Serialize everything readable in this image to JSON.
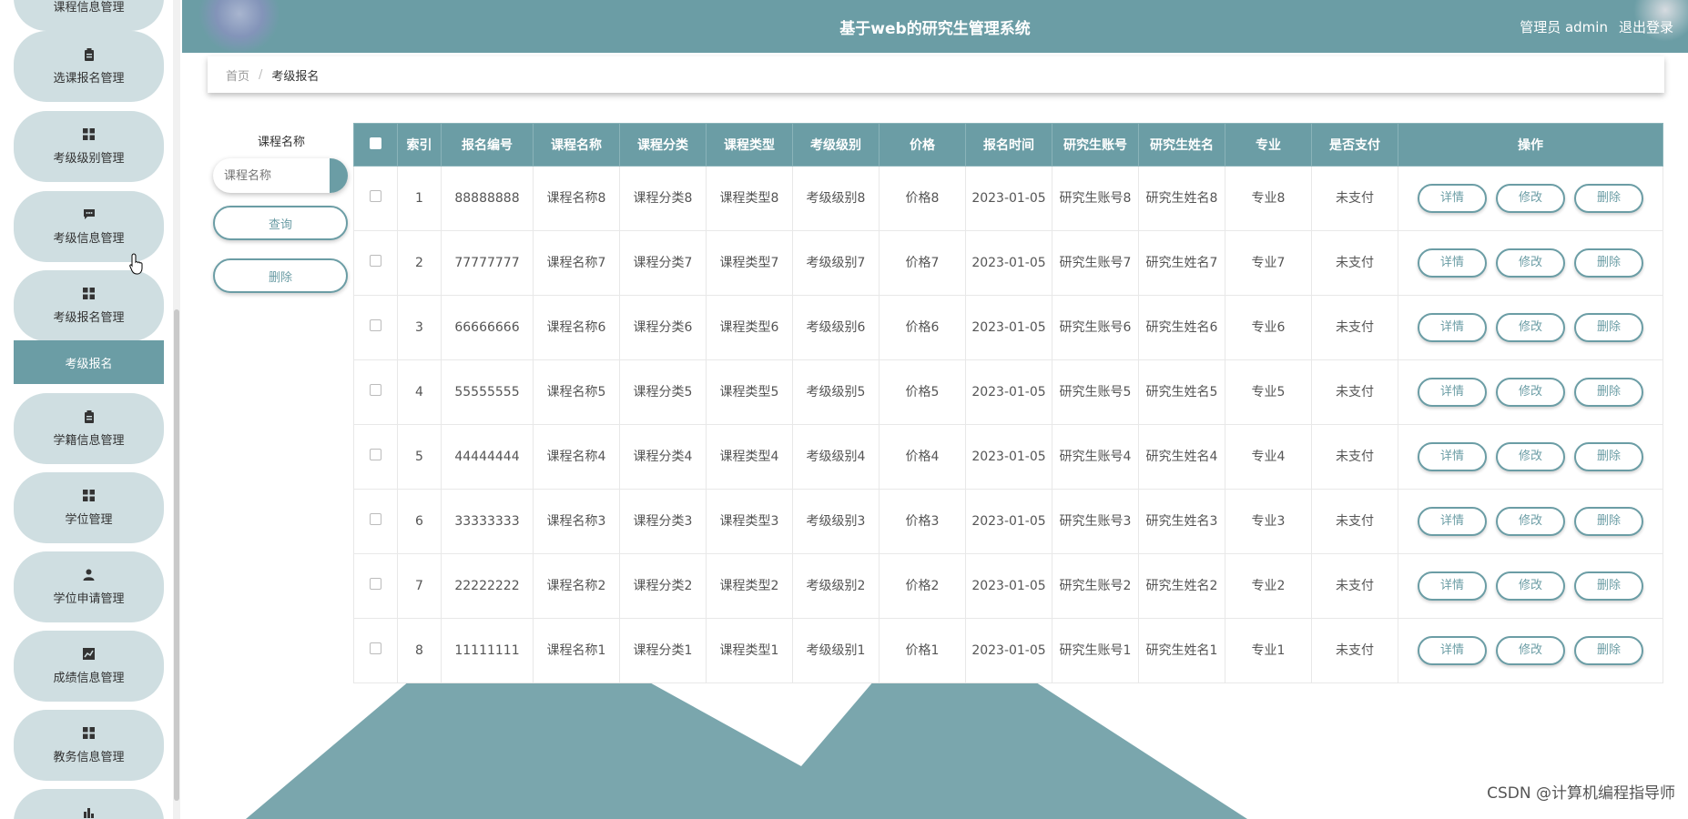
{
  "header": {
    "title": "基于web的研究生管理系统",
    "user_label": "管理员 admin",
    "logout_label": "退出登录"
  },
  "sidebar": {
    "items": [
      {
        "label": "课程信息管理",
        "icon": "book-icon"
      },
      {
        "label": "选课报名管理",
        "icon": "clipboard-icon"
      },
      {
        "label": "考级级别管理",
        "icon": "grid-icon"
      },
      {
        "label": "考级信息管理",
        "icon": "chat-icon"
      },
      {
        "label": "考级报名管理",
        "icon": "grid-icon"
      },
      {
        "label": "学籍信息管理",
        "icon": "clipboard-icon"
      },
      {
        "label": "学位管理",
        "icon": "grid-icon"
      },
      {
        "label": "学位申请管理",
        "icon": "person-icon"
      },
      {
        "label": "成绩信息管理",
        "icon": "chart-icon"
      },
      {
        "label": "教务信息管理",
        "icon": "grid-icon"
      }
    ],
    "active_sub_item": "考级报名"
  },
  "breadcrumb": {
    "home": "首页",
    "separator": "/",
    "current": "考级报名"
  },
  "search": {
    "label": "课程名称",
    "placeholder": "课程名称",
    "query_button": "查询",
    "delete_button": "删除"
  },
  "table": {
    "columns": [
      "索引",
      "报名编号",
      "课程名称",
      "课程分类",
      "课程类型",
      "考级级别",
      "价格",
      "报名时间",
      "研究生账号",
      "研究生姓名",
      "专业",
      "是否支付",
      "操作"
    ],
    "actions": {
      "detail": "详情",
      "edit": "修改",
      "delete": "删除"
    },
    "rows": [
      {
        "index": "1",
        "number": "88888888",
        "course": "课程名称8",
        "category": "课程分类8",
        "type": "课程类型8",
        "level": "考级级别8",
        "price": "价格8",
        "time": "2023-01-05",
        "account": "研究生账号8",
        "name": "研究生姓名8",
        "major": "专业8",
        "paid": "未支付"
      },
      {
        "index": "2",
        "number": "77777777",
        "course": "课程名称7",
        "category": "课程分类7",
        "type": "课程类型7",
        "level": "考级级别7",
        "price": "价格7",
        "time": "2023-01-05",
        "account": "研究生账号7",
        "name": "研究生姓名7",
        "major": "专业7",
        "paid": "未支付"
      },
      {
        "index": "3",
        "number": "66666666",
        "course": "课程名称6",
        "category": "课程分类6",
        "type": "课程类型6",
        "level": "考级级别6",
        "price": "价格6",
        "time": "2023-01-05",
        "account": "研究生账号6",
        "name": "研究生姓名6",
        "major": "专业6",
        "paid": "未支付"
      },
      {
        "index": "4",
        "number": "55555555",
        "course": "课程名称5",
        "category": "课程分类5",
        "type": "课程类型5",
        "level": "考级级别5",
        "price": "价格5",
        "time": "2023-01-05",
        "account": "研究生账号5",
        "name": "研究生姓名5",
        "major": "专业5",
        "paid": "未支付"
      },
      {
        "index": "5",
        "number": "44444444",
        "course": "课程名称4",
        "category": "课程分类4",
        "type": "课程类型4",
        "level": "考级级别4",
        "price": "价格4",
        "time": "2023-01-05",
        "account": "研究生账号4",
        "name": "研究生姓名4",
        "major": "专业4",
        "paid": "未支付"
      },
      {
        "index": "6",
        "number": "33333333",
        "course": "课程名称3",
        "category": "课程分类3",
        "type": "课程类型3",
        "level": "考级级别3",
        "price": "价格3",
        "time": "2023-01-05",
        "account": "研究生账号3",
        "name": "研究生姓名3",
        "major": "专业3",
        "paid": "未支付"
      },
      {
        "index": "7",
        "number": "22222222",
        "course": "课程名称2",
        "category": "课程分类2",
        "type": "课程类型2",
        "level": "考级级别2",
        "price": "价格2",
        "time": "2023-01-05",
        "account": "研究生账号2",
        "name": "研究生姓名2",
        "major": "专业2",
        "paid": "未支付"
      },
      {
        "index": "8",
        "number": "11111111",
        "course": "课程名称1",
        "category": "课程分类1",
        "type": "课程类型1",
        "level": "考级级别1",
        "price": "价格1",
        "time": "2023-01-05",
        "account": "研究生账号1",
        "name": "研究生姓名1",
        "major": "专业1",
        "paid": "未支付"
      }
    ]
  },
  "watermark": "CSDN @计算机编程指导师",
  "colors": {
    "accent": "#6b9da5",
    "menu_bg": "#cfdee1",
    "deco": "#7aa6ad"
  }
}
